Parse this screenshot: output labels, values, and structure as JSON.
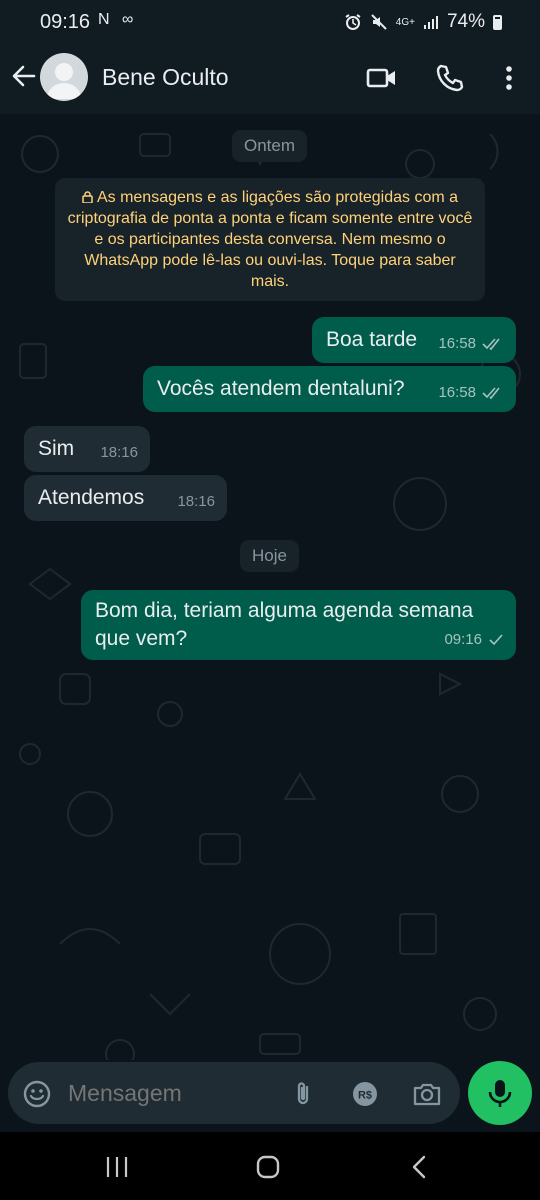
{
  "status_bar": {
    "time": "09:16",
    "left_icons": "N ∞",
    "network": "4G+",
    "battery": "74%"
  },
  "header": {
    "contact_name": "Bene Oculto"
  },
  "chat": {
    "date_yesterday": "Ontem",
    "encryption_notice": "As mensagens e as ligações são protegidas com a criptografia de ponta a ponta e ficam somente entre você e os participantes desta conversa. Nem mesmo o WhatsApp pode lê-las ou ouvi-las. Toque para saber mais.",
    "messages": [
      {
        "direction": "out",
        "text": "Boa tarde",
        "time": "16:58",
        "status": "read-double-tick"
      },
      {
        "direction": "out",
        "text": "Vocês atendem dentaluni?",
        "time": "16:58",
        "status": "read-double-tick"
      },
      {
        "direction": "in",
        "text": "Sim",
        "time": "18:16"
      },
      {
        "direction": "in",
        "text": "Atendemos",
        "time": "18:16"
      },
      {
        "direction": "out",
        "text": "Bom dia, teriam alguma agenda semana que vem?",
        "time": "09:16",
        "status": "sent-single-tick"
      }
    ],
    "date_today": "Hoje"
  },
  "input": {
    "placeholder": "Mensagem",
    "payment_label": "R$"
  },
  "colors": {
    "outgoing_bubble": "#005c4b",
    "incoming_bubble": "#202c33",
    "accent_green": "#21c063",
    "notice_text": "#ffd279"
  }
}
